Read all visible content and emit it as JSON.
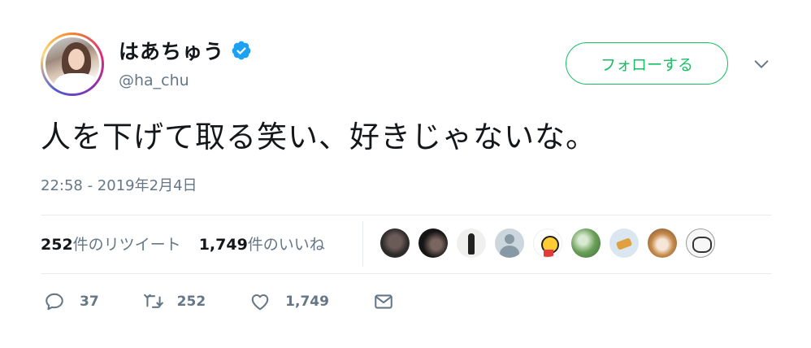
{
  "user": {
    "display_name": "はあちゅう",
    "handle": "@ha_chu",
    "verified": true
  },
  "follow_button": {
    "label": "フォローする"
  },
  "tweet": {
    "text": "人を下げて取る笑い、好きじゃないな。",
    "timestamp": "22:58 - 2019年2月4日"
  },
  "stats": {
    "retweets_count": "252",
    "retweets_label": "件のリツイート",
    "likes_count": "1,749",
    "likes_label": "件のいいね"
  },
  "actions": {
    "replies": "37",
    "retweets": "252",
    "likes": "1,749"
  },
  "colors": {
    "follow_green": "#17bf63",
    "verified_blue": "#1da1f2",
    "muted_text": "#657786"
  },
  "icons": [
    "verified-badge-icon",
    "chevron-down-icon",
    "reply-icon",
    "retweet-icon",
    "like-heart-icon",
    "direct-message-icon"
  ]
}
